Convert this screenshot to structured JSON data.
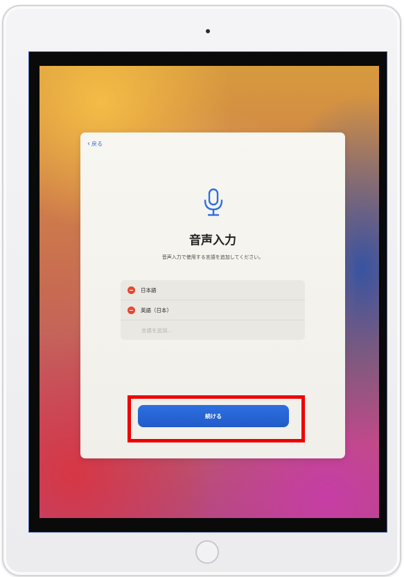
{
  "screen": {
    "back_label": "戻る",
    "title": "音声入力",
    "subtitle": "音声入力で使用する言語を追加してください。",
    "languages": [
      {
        "label": "日本語"
      },
      {
        "label": "英語（日本）"
      }
    ],
    "add_language_placeholder": "言語を追加...",
    "continue_label": "続ける",
    "accent_color": "#2e6fe0",
    "delete_color": "#e8472f"
  },
  "annotation": {
    "highlight_color": "#ee0000"
  },
  "icons": {
    "back": "chevron-left-icon",
    "mic": "microphone-icon",
    "delete": "minus-circle-icon"
  }
}
